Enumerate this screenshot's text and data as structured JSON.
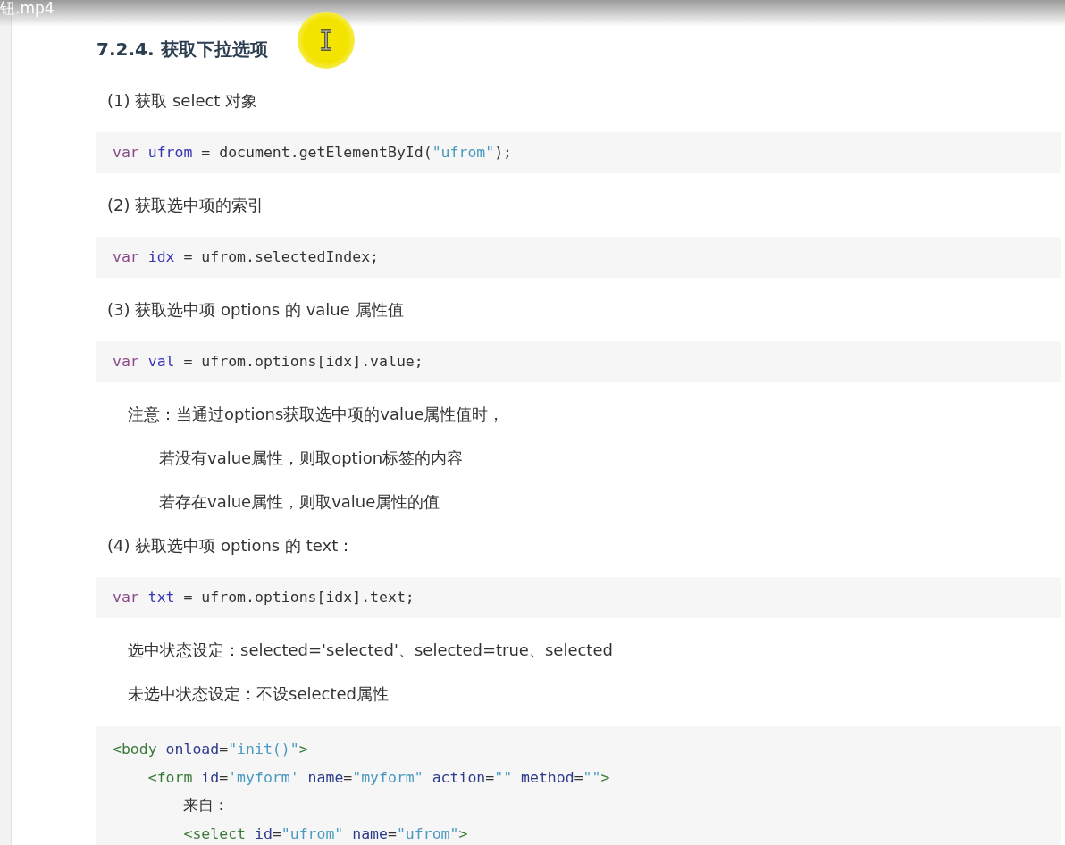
{
  "video_title": "钮.mp4",
  "heading": "7.2.4. 获取下拉选项",
  "blocks": [
    {
      "kind": "para",
      "text": "(1) 获取 select 对象"
    },
    {
      "kind": "code",
      "lines": [
        [
          {
            "kind": "keyword",
            "s": "var"
          },
          {
            "kind": "name",
            "s": " ufrom"
          },
          {
            "kind": "plain",
            "s": " = document.getElementById("
          },
          {
            "kind": "string",
            "s": "\"ufrom\""
          },
          {
            "kind": "plain",
            "s": ");"
          }
        ]
      ]
    },
    {
      "kind": "para",
      "text": "(2) 获取选中项的索引"
    },
    {
      "kind": "code",
      "lines": [
        [
          {
            "kind": "keyword",
            "s": "var"
          },
          {
            "kind": "name",
            "s": " idx"
          },
          {
            "kind": "plain",
            "s": " = ufrom.selectedIndex;"
          }
        ]
      ]
    },
    {
      "kind": "para",
      "text": "(3) 获取选中项 options 的 value 属性值"
    },
    {
      "kind": "code",
      "lines": [
        [
          {
            "kind": "keyword",
            "s": "var"
          },
          {
            "kind": "name",
            "s": " val"
          },
          {
            "kind": "plain",
            "s": " = ufrom.options[idx].value;"
          }
        ]
      ]
    },
    {
      "kind": "note",
      "text": "注意：当通过options获取选中项的value属性值时，"
    },
    {
      "kind": "subnote",
      "text": "若没有value属性，则取option标签的内容"
    },
    {
      "kind": "subnote",
      "text": "若存在value属性，则取value属性的值"
    },
    {
      "kind": "para",
      "text": "(4) 获取选中项 options 的 text："
    },
    {
      "kind": "code",
      "lines": [
        [
          {
            "kind": "keyword",
            "s": "var"
          },
          {
            "kind": "name",
            "s": " txt"
          },
          {
            "kind": "plain",
            "s": " = ufrom.options[idx].text;"
          }
        ]
      ]
    },
    {
      "kind": "note",
      "text": "选中状态设定：selected='selected'、selected=true、selected"
    },
    {
      "kind": "note",
      "text": "未选中状态设定：不设selected属性"
    },
    {
      "kind": "code",
      "lines": [
        [
          {
            "kind": "tag",
            "s": "<body"
          },
          {
            "kind": "attr",
            "s": " onload"
          },
          {
            "kind": "plain",
            "s": "="
          },
          {
            "kind": "string",
            "s": "\"init()\""
          },
          {
            "kind": "tag",
            "s": ">"
          }
        ],
        [
          {
            "kind": "tag",
            "s": "    <form"
          },
          {
            "kind": "attr",
            "s": " id"
          },
          {
            "kind": "plain",
            "s": "="
          },
          {
            "kind": "string",
            "s": "'myform'"
          },
          {
            "kind": "attr",
            "s": " name"
          },
          {
            "kind": "plain",
            "s": "="
          },
          {
            "kind": "string",
            "s": "\"myform\""
          },
          {
            "kind": "attr",
            "s": " action"
          },
          {
            "kind": "plain",
            "s": "="
          },
          {
            "kind": "string",
            "s": "\"\""
          },
          {
            "kind": "attr",
            "s": " method"
          },
          {
            "kind": "plain",
            "s": "="
          },
          {
            "kind": "string",
            "s": "\"\""
          },
          {
            "kind": "tag",
            "s": ">"
          }
        ],
        [
          {
            "kind": "plain",
            "s": "        来自："
          }
        ],
        [
          {
            "kind": "tag",
            "s": "        <select"
          },
          {
            "kind": "attr",
            "s": " id"
          },
          {
            "kind": "plain",
            "s": "="
          },
          {
            "kind": "string",
            "s": "\"ufrom\""
          },
          {
            "kind": "attr",
            "s": " name"
          },
          {
            "kind": "plain",
            "s": "="
          },
          {
            "kind": "string",
            "s": "\"ufrom\""
          },
          {
            "kind": "tag",
            "s": ">"
          }
        ]
      ]
    }
  ]
}
